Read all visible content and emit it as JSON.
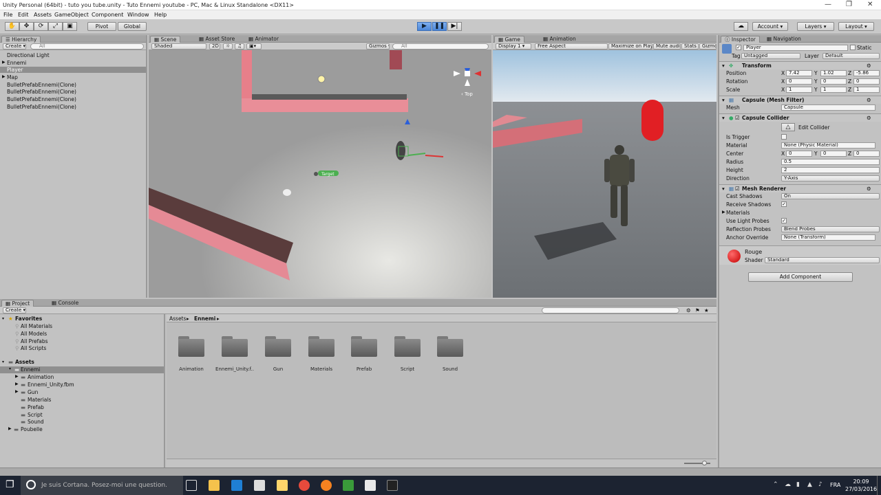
{
  "window": {
    "title": "Unity Personal (64bit) - tuto you tube.unity - Tuto Ennemi youtube - PC, Mac & Linux Standalone <DX11>"
  },
  "menu": [
    "File",
    "Edit",
    "Assets",
    "GameObject",
    "Component",
    "Window",
    "Help"
  ],
  "toolbar": {
    "pivot": "Pivot",
    "global": "Global",
    "account": "Account",
    "layers": "Layers",
    "layout": "Layout"
  },
  "hierarchy": {
    "tab": "Hierarchy",
    "create": "Create",
    "search": "All",
    "items": [
      "Directional Light",
      "Ennemi",
      "Player",
      "Map",
      "BulletPrefabEnnemi(Clone)",
      "BulletPrefabEnnemi(Clone)",
      "BulletPrefabEnnemi(Clone)",
      "BulletPrefabEnnemi(Clone)"
    ],
    "selected": "Player"
  },
  "scene": {
    "tabs": [
      "Scene",
      "Asset Store",
      "Animator"
    ],
    "shaded": "Shaded",
    "mode2d": "2D",
    "gizmos": "Gizmos",
    "search": "All",
    "target_label": "Target",
    "top_label": "Top"
  },
  "game": {
    "tabs": [
      "Game",
      "Animation"
    ],
    "display": "Display 1",
    "aspect": "Free Aspect",
    "options": [
      "Maximize on Play",
      "Mute audio",
      "Stats",
      "Gizmo"
    ]
  },
  "inspector": {
    "tabs": [
      "Inspector",
      "Navigation"
    ],
    "name": "Player",
    "static": "Static",
    "tag_label": "Tag",
    "tag": "Untagged",
    "layer_label": "Layer",
    "layer": "Default",
    "transform": {
      "title": "Transform",
      "rows": [
        {
          "label": "Position",
          "x": "7.42",
          "y": "1.02",
          "z": "-5.86"
        },
        {
          "label": "Rotation",
          "x": "0",
          "y": "0",
          "z": "0"
        },
        {
          "label": "Scale",
          "x": "1",
          "y": "1",
          "z": "1"
        }
      ]
    },
    "mesh_filter": {
      "title": "Capsule (Mesh Filter)",
      "mesh_label": "Mesh",
      "mesh": "Capsule"
    },
    "capsule_collider": {
      "title": "Capsule Collider",
      "edit": "Edit Collider",
      "trigger": "Is Trigger",
      "material_label": "Material",
      "material": "None (Physic Material)",
      "center_label": "Center",
      "cx": "0",
      "cy": "0",
      "cz": "0",
      "radius_label": "Radius",
      "radius": "0.5",
      "height_label": "Height",
      "height": "2",
      "direction_label": "Direction",
      "direction": "Y-Axis"
    },
    "mesh_renderer": {
      "title": "Mesh Renderer",
      "cast_label": "Cast Shadows",
      "cast": "On",
      "receive": "Receive Shadows",
      "materials": "Materials",
      "light_probes": "Use Light Probes",
      "refl_label": "Reflection Probes",
      "refl": "Blend Probes",
      "anchor_label": "Anchor Override",
      "anchor": "None (Transform)"
    },
    "material": {
      "name": "Rouge",
      "shader_label": "Shader",
      "shader": "Standard"
    },
    "add_component": "Add Component"
  },
  "project": {
    "tabs": [
      "Project",
      "Console"
    ],
    "create": "Create",
    "breadcrumb": [
      "Assets",
      "Ennemi"
    ],
    "favorites": {
      "title": "Favorites",
      "items": [
        "All Materials",
        "All Models",
        "All Prefabs",
        "All Scripts"
      ]
    },
    "assets": {
      "title": "Assets",
      "items": [
        "Ennemi",
        "Animation",
        "Ennemi_Unity.fbm",
        "Gun",
        "Materials",
        "Prefab",
        "Script",
        "Sound",
        "Poubelle"
      ]
    },
    "folders": [
      "Animation",
      "Ennemi_Unity.f..",
      "Gun",
      "Materials",
      "Prefab",
      "Script",
      "Sound"
    ]
  },
  "taskbar": {
    "cortana": "Je suis Cortana. Posez-moi une question.",
    "lang": "FRA",
    "time": "20:09",
    "date": "27/03/2016"
  }
}
